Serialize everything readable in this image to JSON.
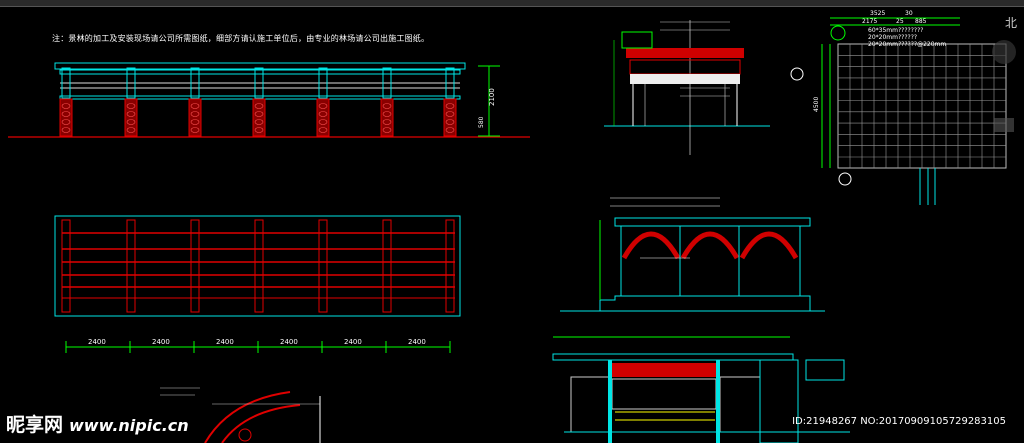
{
  "note": "注：景林的加工及安装现场请公司所需图纸，细部方请认施工单位后，由专业的林场请公司出施工图纸。",
  "dims_bottom": [
    "2400",
    "2400",
    "2400",
    "2400",
    "2400",
    "2400"
  ],
  "dim_height": "2100",
  "dim_side": "580",
  "plan_top": [
    "3525",
    "30",
    "2175",
    "25",
    "885"
  ],
  "plan_labels": [
    "60*35mm????????",
    "20*20mm??????",
    "20*20mm??????@220mm"
  ],
  "plan_side": "4500",
  "north": "北",
  "watermark": {
    "logo": "昵享网",
    "site": "www.nipic.cn"
  },
  "id_text": "ID:21948267 NO:20170909105729283105",
  "colors": {
    "structure": "#ffffff",
    "cyan": "#00e5e5",
    "red": "#e00000",
    "green": "#00ff00",
    "yellow": "#ffff00"
  }
}
